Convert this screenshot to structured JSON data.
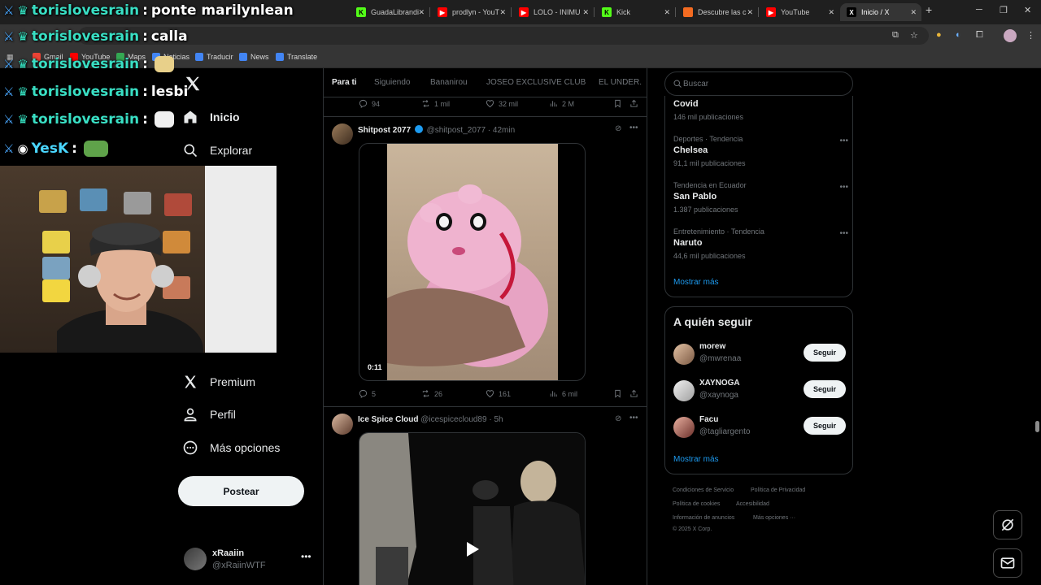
{
  "browser": {
    "tabs": [
      {
        "label": "GuadaLibrandi",
        "icon": "kick-icon",
        "color": "#53fc18"
      },
      {
        "label": "prodlyn - YouT",
        "icon": "youtube-icon",
        "color": "#ff0000"
      },
      {
        "label": "LOLO - INIMU",
        "icon": "youtube-icon",
        "color": "#ff0000"
      },
      {
        "label": "Kick",
        "icon": "kick-icon",
        "color": "#53fc18"
      },
      {
        "label": "Descubre las c",
        "icon": "page-icon",
        "color": "#f36b21"
      },
      {
        "label": "YouTube",
        "icon": "youtube-icon",
        "color": "#ff0000"
      },
      {
        "label": "Inicio / X",
        "icon": "x-icon",
        "color": "#000000",
        "active": true
      }
    ],
    "bookmarks": [
      "Gmail",
      "YouTube",
      "Maps",
      "Noticias",
      "Traducir",
      "News",
      "Translate"
    ]
  },
  "chat": [
    {
      "user": "torislovesrain",
      "message": "ponte marilynlean"
    },
    {
      "user": "torislovesrain",
      "message": "calla"
    },
    {
      "user": "torislovesrain",
      "message": ""
    },
    {
      "user": "torislovesrain",
      "message": "lesbi"
    },
    {
      "user": "torislovesrain",
      "message": ""
    },
    {
      "user": "YesK",
      "message": ""
    }
  ],
  "nav": {
    "items": [
      {
        "label": "Inicio",
        "icon": "home-icon",
        "bold": true
      },
      {
        "label": "Explorar",
        "icon": "search-icon"
      },
      {
        "label": "Premium",
        "icon": "x-premium-icon"
      },
      {
        "label": "Perfil",
        "icon": "profile-icon"
      },
      {
        "label": "Más opciones",
        "icon": "more-options-icon"
      }
    ],
    "post_button": "Postear",
    "account": {
      "name": "xRaaiin",
      "handle": "@xRaiinWTF"
    }
  },
  "feed": {
    "tabs": [
      "Para ti",
      "Siguiendo",
      "Bananirou",
      "JOSEO EXCLUSIVE CLUB",
      "EL UNDER."
    ],
    "prev_stats": {
      "replies": "94",
      "reposts": "1 mil",
      "likes": "32 mil",
      "views": "2 M"
    },
    "posts": [
      {
        "name": "Shitpost 2077",
        "verified": true,
        "handle": "@shitpost_2077",
        "time": "42min",
        "video_duration": "0:11",
        "stats": {
          "replies": "5",
          "reposts": "26",
          "likes": "161",
          "views": "6 mil"
        }
      },
      {
        "name": "Ice Spice Cloud",
        "verified": false,
        "handle": "@icespicecloud89",
        "time": "5h"
      }
    ]
  },
  "sidebar": {
    "search_placeholder": "Buscar",
    "trends": [
      {
        "category": "",
        "name": "Covid",
        "count": "146 mil publicaciones"
      },
      {
        "category": "Deportes · Tendencia",
        "name": "Chelsea",
        "count": "91,1 mil publicaciones"
      },
      {
        "category": "Tendencia en Ecuador",
        "name": "San Pablo",
        "count": "1.387 publicaciones"
      },
      {
        "category": "Entretenimiento · Tendencia",
        "name": "Naruto",
        "count": "44,6 mil publicaciones"
      }
    ],
    "show_more": "Mostrar más",
    "who_to_follow": {
      "title": "A quién seguir",
      "users": [
        {
          "name": "morew",
          "handle": "@mwrenaa",
          "button": "Seguir"
        },
        {
          "name": "XAYNOGA",
          "handle": "@xaynoga",
          "button": "Seguir"
        },
        {
          "name": "Facu",
          "handle": "@tagliargento",
          "button": "Seguir"
        }
      ],
      "show_more": "Mostrar más"
    },
    "footer": [
      "Condiciones de Servicio",
      "Política de Privacidad",
      "Política de cookies",
      "Accesibilidad",
      "Información de anuncios",
      "Más opciones ···",
      "© 2025 X Corp."
    ]
  },
  "colors": {
    "accent": "#1d9bf0",
    "background": "#000000",
    "border": "#2f3336",
    "muted": "#71767b"
  }
}
